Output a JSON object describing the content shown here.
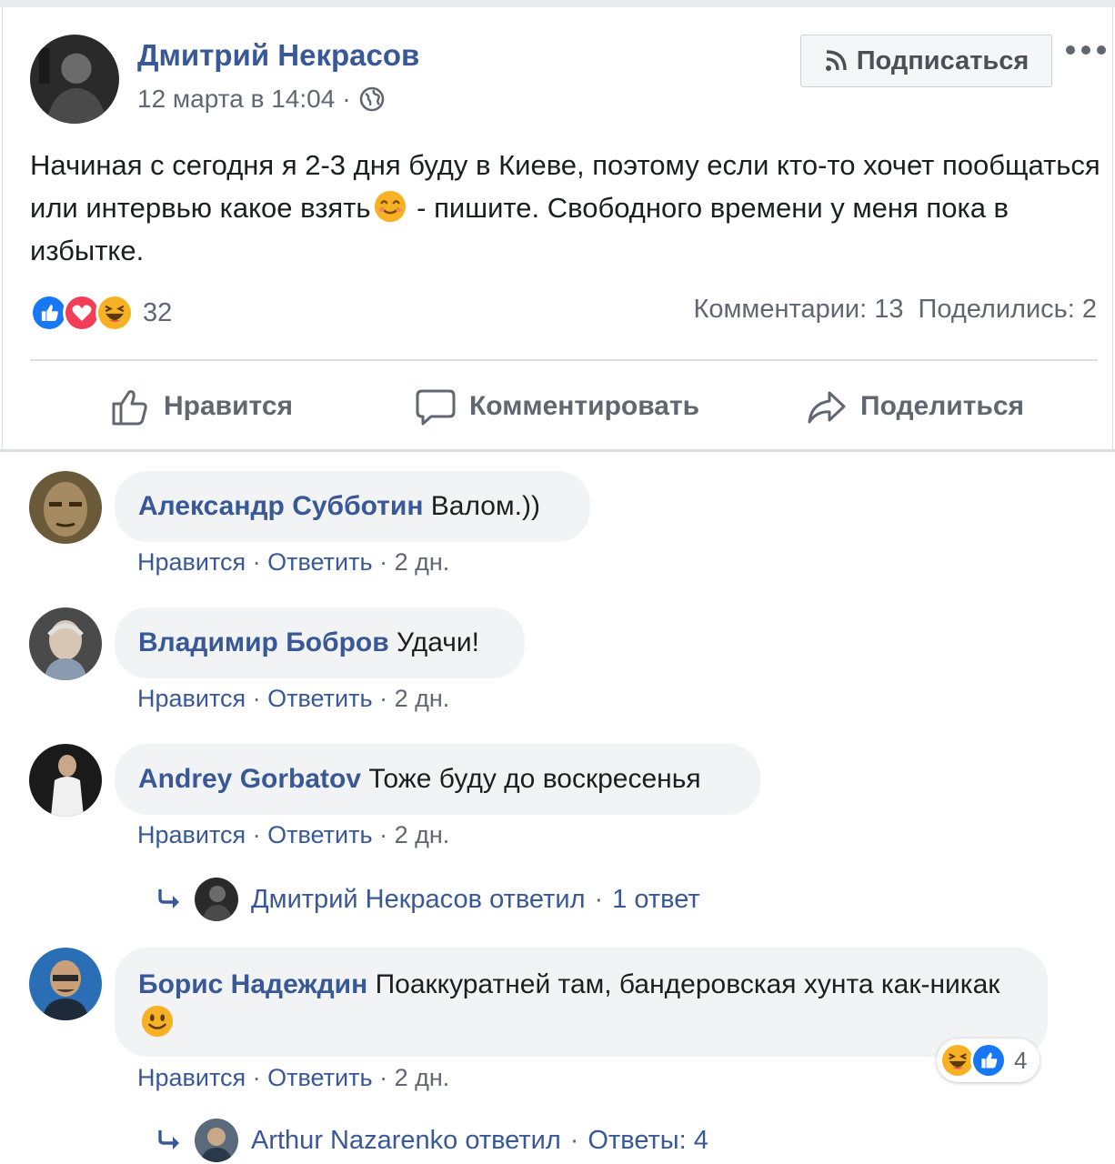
{
  "post": {
    "author": "Дмитрий Некрасов",
    "date": "12 марта в 14:04",
    "separator": "·",
    "follow_label": "Подписаться",
    "text_part1": "Начиная с сегодня я 2-3 дня буду в Киеве, поэтому если кто-то хочет пообщаться или интервью какое взять",
    "text_part2": " - пишите. Свободного времени у меня пока в избытке.",
    "reactions_count": "32",
    "comments_count": "Комментарии: 13",
    "shares_count": "Поделились: 2",
    "actions": {
      "like": "Нравится",
      "comment": "Комментировать",
      "share": "Поделиться"
    }
  },
  "comments": [
    {
      "author": "Александр Субботин",
      "text": " Валом.))",
      "like": "Нравится",
      "reply": "Ответить",
      "time": "2 дн."
    },
    {
      "author": "Владимир Бобров",
      "text": " Удачи!",
      "like": "Нравится",
      "reply": "Ответить",
      "time": "2 дн."
    },
    {
      "author": "Andrey Gorbatov",
      "text": " Тоже буду до воскресенья",
      "like": "Нравится",
      "reply": "Ответить",
      "time": "2 дн.",
      "replies": {
        "text": "Дмитрий Некрасов ответил",
        "count": "1 ответ"
      }
    },
    {
      "author": "Борис Надеждин",
      "text_part1": " Поаккуратней там, бандеровская хунта как-никак ",
      "like": "Нравится",
      "reply": "Ответить",
      "time": "2 дн.",
      "reactions_count": "4",
      "replies": {
        "text": "Arthur Nazarenko ответил",
        "count": "Ответы: 4"
      }
    }
  ],
  "colors": {
    "link": "#385898",
    "meta": "#606770",
    "bubble": "#f2f3f5",
    "like": "#1877f2",
    "love": "#f33e58",
    "haha": "#f7b125"
  }
}
